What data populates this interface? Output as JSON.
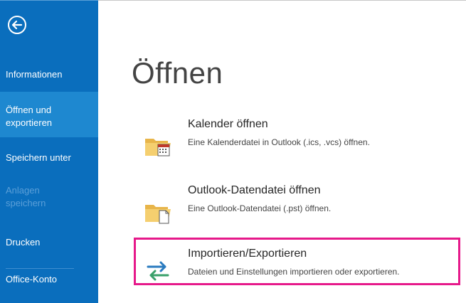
{
  "sidebar": {
    "back_icon": "back-arrow-icon",
    "items": [
      {
        "label": "Informationen"
      },
      {
        "label": "Öffnen und exportieren"
      },
      {
        "label": "Speichern unter"
      },
      {
        "label": "Anlagen speichern"
      },
      {
        "label": "Drucken"
      },
      {
        "label": "Office-Konto"
      }
    ]
  },
  "main": {
    "title": "Öffnen",
    "options": [
      {
        "title": "Kalender öffnen",
        "description": "Eine Kalenderdatei in Outlook (.ics, .vcs) öffnen.",
        "icon": "calendar-folder-icon"
      },
      {
        "title": "Outlook-Datendatei öffnen",
        "description": "Eine Outlook-Datendatei (.pst) öffnen.",
        "icon": "data-file-folder-icon"
      },
      {
        "title": "Importieren/Exportieren",
        "description": "Dateien und Einstellungen importieren oder exportieren.",
        "icon": "import-export-arrows-icon"
      }
    ]
  },
  "colors": {
    "sidebar_bg": "#0a6ebd",
    "sidebar_active": "#1e88d0",
    "highlight": "#e6198a"
  }
}
